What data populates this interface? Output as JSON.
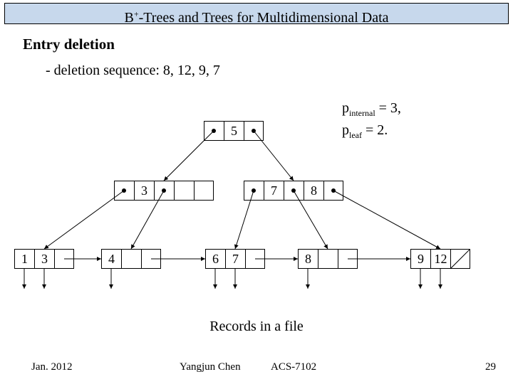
{
  "title_prefix": "B",
  "title_suffix": "-Trees and Trees for Multidimensional Data",
  "subhead": "Entry deletion",
  "sequence": "- deletion sequence: 8, 12, 9, 7",
  "p_internal_label_prefix": "p",
  "p_internal_label_sub": "internal",
  "p_internal_eq": " = 3,",
  "p_leaf_label_prefix": "p",
  "p_leaf_label_sub": "leaf",
  "p_leaf_eq": " = 2.",
  "records_label": "Records in a file",
  "footer": {
    "date": "Jan. 2012",
    "author": "Yangjun Chen",
    "course": "ACS-7102",
    "page": "29"
  },
  "tree": {
    "root": [
      "5"
    ],
    "level1_left": [
      "3"
    ],
    "level1_right": [
      "7",
      "8"
    ],
    "leaves": [
      {
        "keys": [
          "1",
          "3"
        ]
      },
      {
        "keys": [
          "4"
        ]
      },
      {
        "keys": [
          "6",
          "7"
        ]
      },
      {
        "keys": [
          "8"
        ]
      },
      {
        "keys": [
          "9",
          "12"
        ]
      }
    ]
  }
}
